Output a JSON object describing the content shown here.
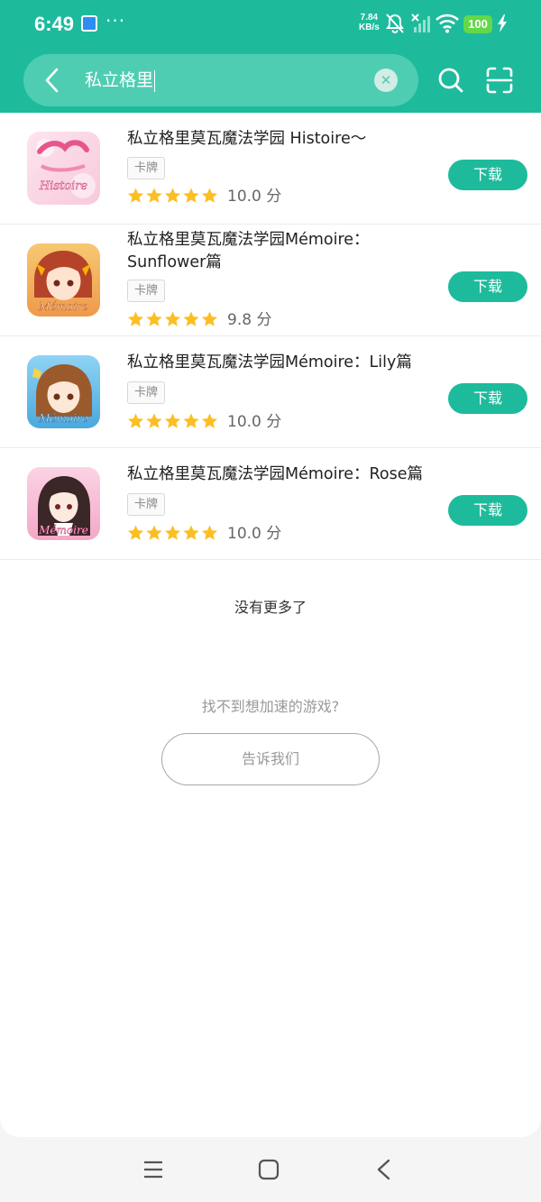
{
  "status_bar": {
    "time": "6:49",
    "network_speed_value": "7.84",
    "network_speed_unit": "KB/s",
    "battery": "100"
  },
  "search": {
    "query": "私立格里",
    "back_icon": "chevron-left-icon",
    "clear_icon": "close-icon",
    "search_icon": "search-icon",
    "scan_icon": "scan-icon"
  },
  "results": [
    {
      "title": "私立格里莫瓦魔法学园 Histoire～",
      "tag": "卡牌",
      "rating": 5,
      "score": "10.0 分",
      "download_label": "下载",
      "icon_text": "Histoire"
    },
    {
      "title": "私立格里莫瓦魔法学园Mémoire：Sunflower篇",
      "tag": "卡牌",
      "rating": 5,
      "score": "9.8 分",
      "download_label": "下载",
      "icon_text": "Mémoire"
    },
    {
      "title": "私立格里莫瓦魔法学园Mémoire：Lily篇",
      "tag": "卡牌",
      "rating": 5,
      "score": "10.0 分",
      "download_label": "下载",
      "icon_text": "Mémoire"
    },
    {
      "title": "私立格里莫瓦魔法学园Mémoire：Rose篇",
      "tag": "卡牌",
      "rating": 5,
      "score": "10.0 分",
      "download_label": "下载",
      "icon_text": "Mémoire"
    }
  ],
  "footer": {
    "no_more": "没有更多了",
    "hint": "找不到想加速的游戏?",
    "tell_us": "告诉我们"
  },
  "colors": {
    "accent": "#1dbb9c",
    "star": "#fbbf24"
  },
  "nav": {
    "menu_icon": "menu-icon",
    "home_icon": "home-square-icon",
    "back_icon": "back-triangle-icon"
  }
}
